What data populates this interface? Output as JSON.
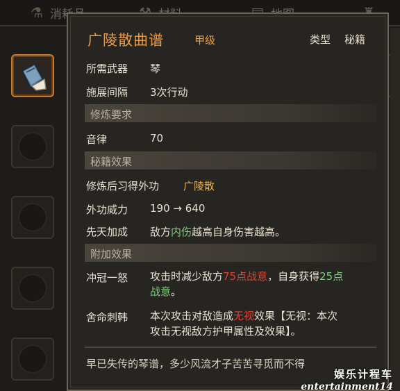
{
  "tabs": [
    "消耗品",
    "材料",
    "地图"
  ],
  "tooltip": {
    "title": "广陵散曲谱",
    "grade": "甲级",
    "type_label": "类型",
    "type_value": "秘籍",
    "required_weapon": {
      "label": "所需武器",
      "value": "琴"
    },
    "cast_interval": {
      "label": "施展间隔",
      "value": "3次行动"
    },
    "sections": {
      "requirements": "修炼要求",
      "manual_effects": "秘籍效果",
      "extra_effects": "附加效果"
    },
    "rhythm": {
      "label": "音律",
      "value": "70"
    },
    "learned_skill": {
      "label": "修炼后习得外功",
      "value": "广陵散"
    },
    "external_power": {
      "label": "外功威力",
      "value": "190 → 640"
    },
    "innate_bonus": {
      "label": "先天加成",
      "text_a": "敌方",
      "highlight": "内伤",
      "text_b": "越高自身伤害越高。"
    },
    "effect1": {
      "label": "冲冠一怒",
      "line1_a": "攻击时减少敌方",
      "line1_red": "75点战意",
      "line1_b": "，自身获得",
      "line1_green": "25点",
      "line2_green": "战意",
      "line2_b": "。"
    },
    "effect2": {
      "label": "舍命刺韩",
      "line1_a": "本次攻击对敌造成",
      "line1_red": "无视",
      "line1_b": "效果【无视：本次",
      "line2": "攻击无视敌方护甲属性及效果】。"
    },
    "flavor": "早已失传的琴谱，多少风流才子苦苦寻觅而不得"
  },
  "watermark": {
    "cn": "娱乐计程车",
    "en": "entertainment14"
  },
  "colors": {
    "title": "#e79a48",
    "red": "#e0423b",
    "green": "#7cd07a",
    "selected_border": "#c67a2c"
  }
}
